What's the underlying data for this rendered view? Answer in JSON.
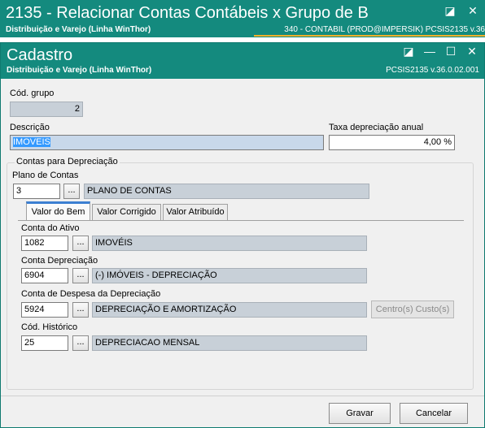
{
  "outer": {
    "title": "2135 - Relacionar Contas Contábeis x Grupo de B",
    "subtitle": "Distribuição e Varejo (Linha WinThor)",
    "info": "340 - CONTABIL (PROD@IMPERSIK)   PCSIS2135  v.36"
  },
  "modal": {
    "title": "Cadastro",
    "subtitle": "Distribuição e Varejo (Linha WinThor)",
    "version": "PCSIS2135  v.36.0.02.001"
  },
  "form": {
    "cod_grupo_label": "Cód. grupo",
    "cod_grupo_value": "2",
    "descricao_label": "Descrição",
    "descricao_value": "IMOVEIS",
    "taxa_label": "Taxa depreciação anual",
    "taxa_value": "4,00 %",
    "group_label": "Contas para Depreciação",
    "plano_label": "Plano de Contas",
    "plano_code": "3",
    "plano_desc": "PLANO DE CONTAS",
    "tabs": [
      {
        "label": "Valor do Bem",
        "active": true
      },
      {
        "label": "Valor Corrigido",
        "active": false
      },
      {
        "label": "Valor Atribuído",
        "active": false
      }
    ],
    "conta_ativo_label": "Conta do Ativo",
    "conta_ativo_code": "1082",
    "conta_ativo_desc": "IMOVÉIS",
    "conta_dep_label": "Conta Depreciação",
    "conta_dep_code": "6904",
    "conta_dep_desc": "(-) IMÓVEIS - DEPRECIAÇÃO",
    "conta_desp_label": "Conta de Despesa da Depreciação",
    "conta_desp_code": "5924",
    "conta_desp_desc": "DEPRECIAÇÃO E AMORTIZAÇÃO",
    "centro_custo_label": "Centro(s) Custo(s)",
    "cod_hist_label": "Cód. Histórico",
    "cod_hist_code": "25",
    "cod_hist_desc": "DEPRECIACAO MENSAL",
    "dots_label": "..."
  },
  "footer": {
    "gravar_label": "Gravar",
    "cancelar_label": "Cancelar"
  },
  "controls": {
    "restore": "◪",
    "minimize": "—",
    "maximize": "☐",
    "close": "✕"
  }
}
